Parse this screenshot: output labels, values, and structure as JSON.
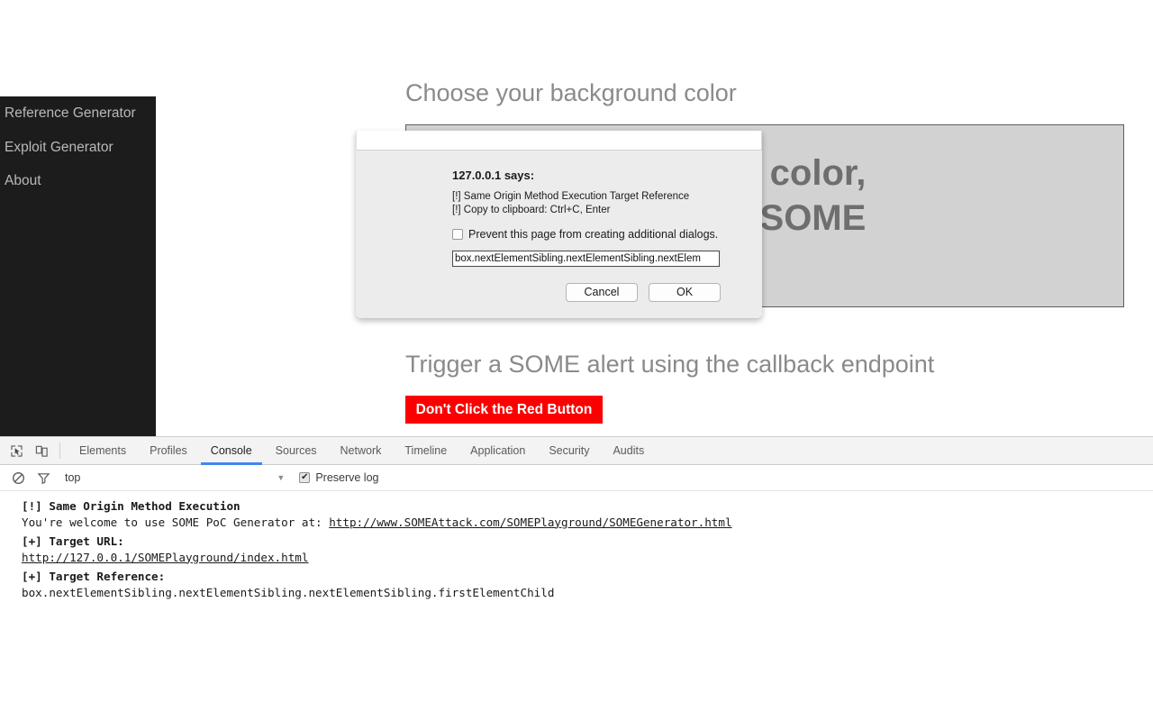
{
  "sidebar": {
    "items": [
      {
        "label": "Reference Generator"
      },
      {
        "label": "Exploit Generator"
      },
      {
        "label": "About"
      }
    ]
  },
  "page": {
    "background_heading": "Choose your background color",
    "color_box_text": "Click me to change color,\nor click me to Find SOME",
    "trigger_heading": "Trigger a SOME alert using the callback endpoint",
    "red_button_label": "Don't Click the Red Button",
    "colors": {
      "red_button": "#fa0000",
      "color_box": "#d2d2d2",
      "sidebar": "#1c1c1c",
      "heading_text": "#8a8a8a"
    }
  },
  "dialog": {
    "origin": "127.0.0.1 says:",
    "message_lines": [
      "[!] Same Origin Method Execution Target Reference",
      "[!] Copy to clipboard: Ctrl+C, Enter"
    ],
    "prevent_label": "Prevent this page from creating additional dialogs.",
    "prevent_checked": false,
    "input_value": "box.nextElementSibling.nextElementSibling.nextElementSibling.firstElementChild",
    "input_visible_text": "box.nextElementSibling.nextElementSibling.nextElem",
    "cancel_label": "Cancel",
    "ok_label": "OK"
  },
  "devtools": {
    "icons": {
      "inspect": "inspect-element-icon",
      "device": "device-toolbar-icon",
      "clear": "clear-console-icon",
      "filter": "filter-icon"
    },
    "tabs": [
      {
        "label": "Elements",
        "active": false
      },
      {
        "label": "Profiles",
        "active": false
      },
      {
        "label": "Console",
        "active": true
      },
      {
        "label": "Sources",
        "active": false
      },
      {
        "label": "Network",
        "active": false
      },
      {
        "label": "Timeline",
        "active": false
      },
      {
        "label": "Application",
        "active": false
      },
      {
        "label": "Security",
        "active": false
      },
      {
        "label": "Audits",
        "active": false
      }
    ],
    "active_tab_underline": "#4285f4",
    "filterbar": {
      "context": "top",
      "caret": "▼",
      "preserve_log_label": "Preserve log",
      "preserve_log_checked": true,
      "check_glyph": "✔"
    },
    "console": {
      "entries": [
        {
          "title": "[!] Same Origin Method Execution",
          "text_before": "You're welcome to use SOME PoC Generator at: ",
          "link": "http://www.SOMEAttack.com/SOMEPlayground/SOMEGenerator.html"
        },
        {
          "title": "[+] Target URL:",
          "text_before": "",
          "link": "http://127.0.0.1/SOMEPlayground/index.html"
        },
        {
          "title": "[+] Target Reference:",
          "text_before": "box.nextElementSibling.nextElementSibling.nextElementSibling.firstElementChild",
          "link": ""
        }
      ]
    }
  }
}
